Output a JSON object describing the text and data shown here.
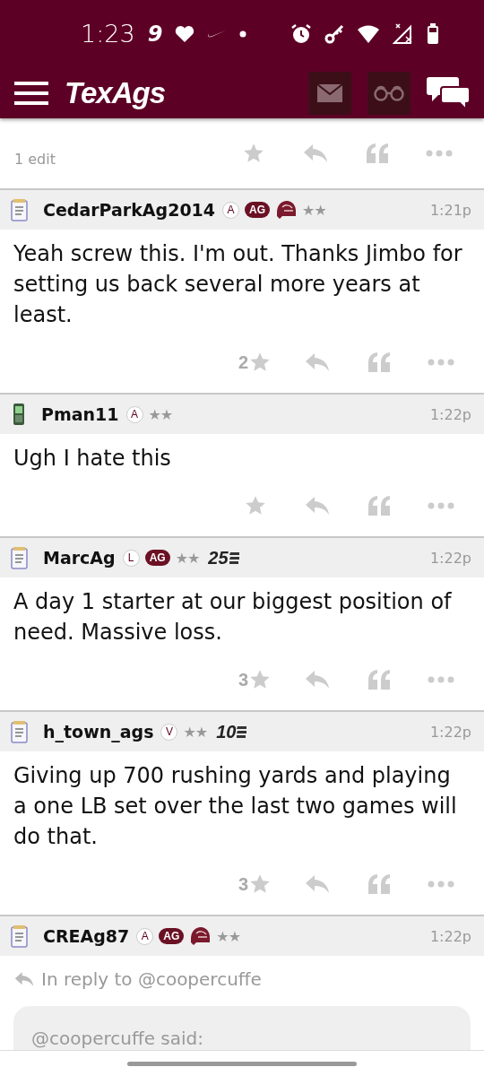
{
  "status_bar": {
    "time": "1:23",
    "app_badge": "9"
  },
  "app_bar": {
    "logo": "TexAgs"
  },
  "top_post": {
    "edit_note": "1 edit"
  },
  "posts": [
    {
      "user": "CedarParkAg2014",
      "kind": "notepad",
      "badges": [
        {
          "kind": "letter",
          "text": "A"
        },
        {
          "kind": "tag",
          "text": "AG"
        },
        {
          "kind": "helmet"
        }
      ],
      "star_badge": "★★",
      "time": "1:21p",
      "body": "Yeah screw this. I'm out. Thanks Jimbo for setting us back several more years at least.",
      "likes": "2"
    },
    {
      "user": "Pman11",
      "kind": "phone",
      "badges": [
        {
          "kind": "letter",
          "text": "A"
        }
      ],
      "star_badge": "★★",
      "time": "1:22p",
      "body": "Ugh I hate this"
    },
    {
      "user": "MarcAg",
      "kind": "notepad",
      "badges": [
        {
          "kind": "letter",
          "text": "L"
        },
        {
          "kind": "tag",
          "text": "AG"
        }
      ],
      "star_badge": "★★",
      "rank": "25",
      "time": "1:22p",
      "body": "A day 1 starter at our biggest position of need. Massive loss.",
      "likes": "3"
    },
    {
      "user": "h_town_ags",
      "kind": "notepad",
      "badges": [
        {
          "kind": "letter",
          "text": "V"
        }
      ],
      "star_badge": "★★",
      "rank": "10",
      "time": "1:22p",
      "body": "Giving up 700 rushing yards and playing a one LB set over the last two games will do that.",
      "likes": "3"
    },
    {
      "user": "CREAg87",
      "kind": "notepad",
      "badges": [
        {
          "kind": "letter",
          "text": "A"
        },
        {
          "kind": "tag",
          "text": "AG"
        },
        {
          "kind": "helmet"
        }
      ],
      "star_badge": "★★",
      "time": "1:22p",
      "reply_to": "In reply to @coopercuffe",
      "quote_author": "@coopercuffe said:"
    }
  ]
}
